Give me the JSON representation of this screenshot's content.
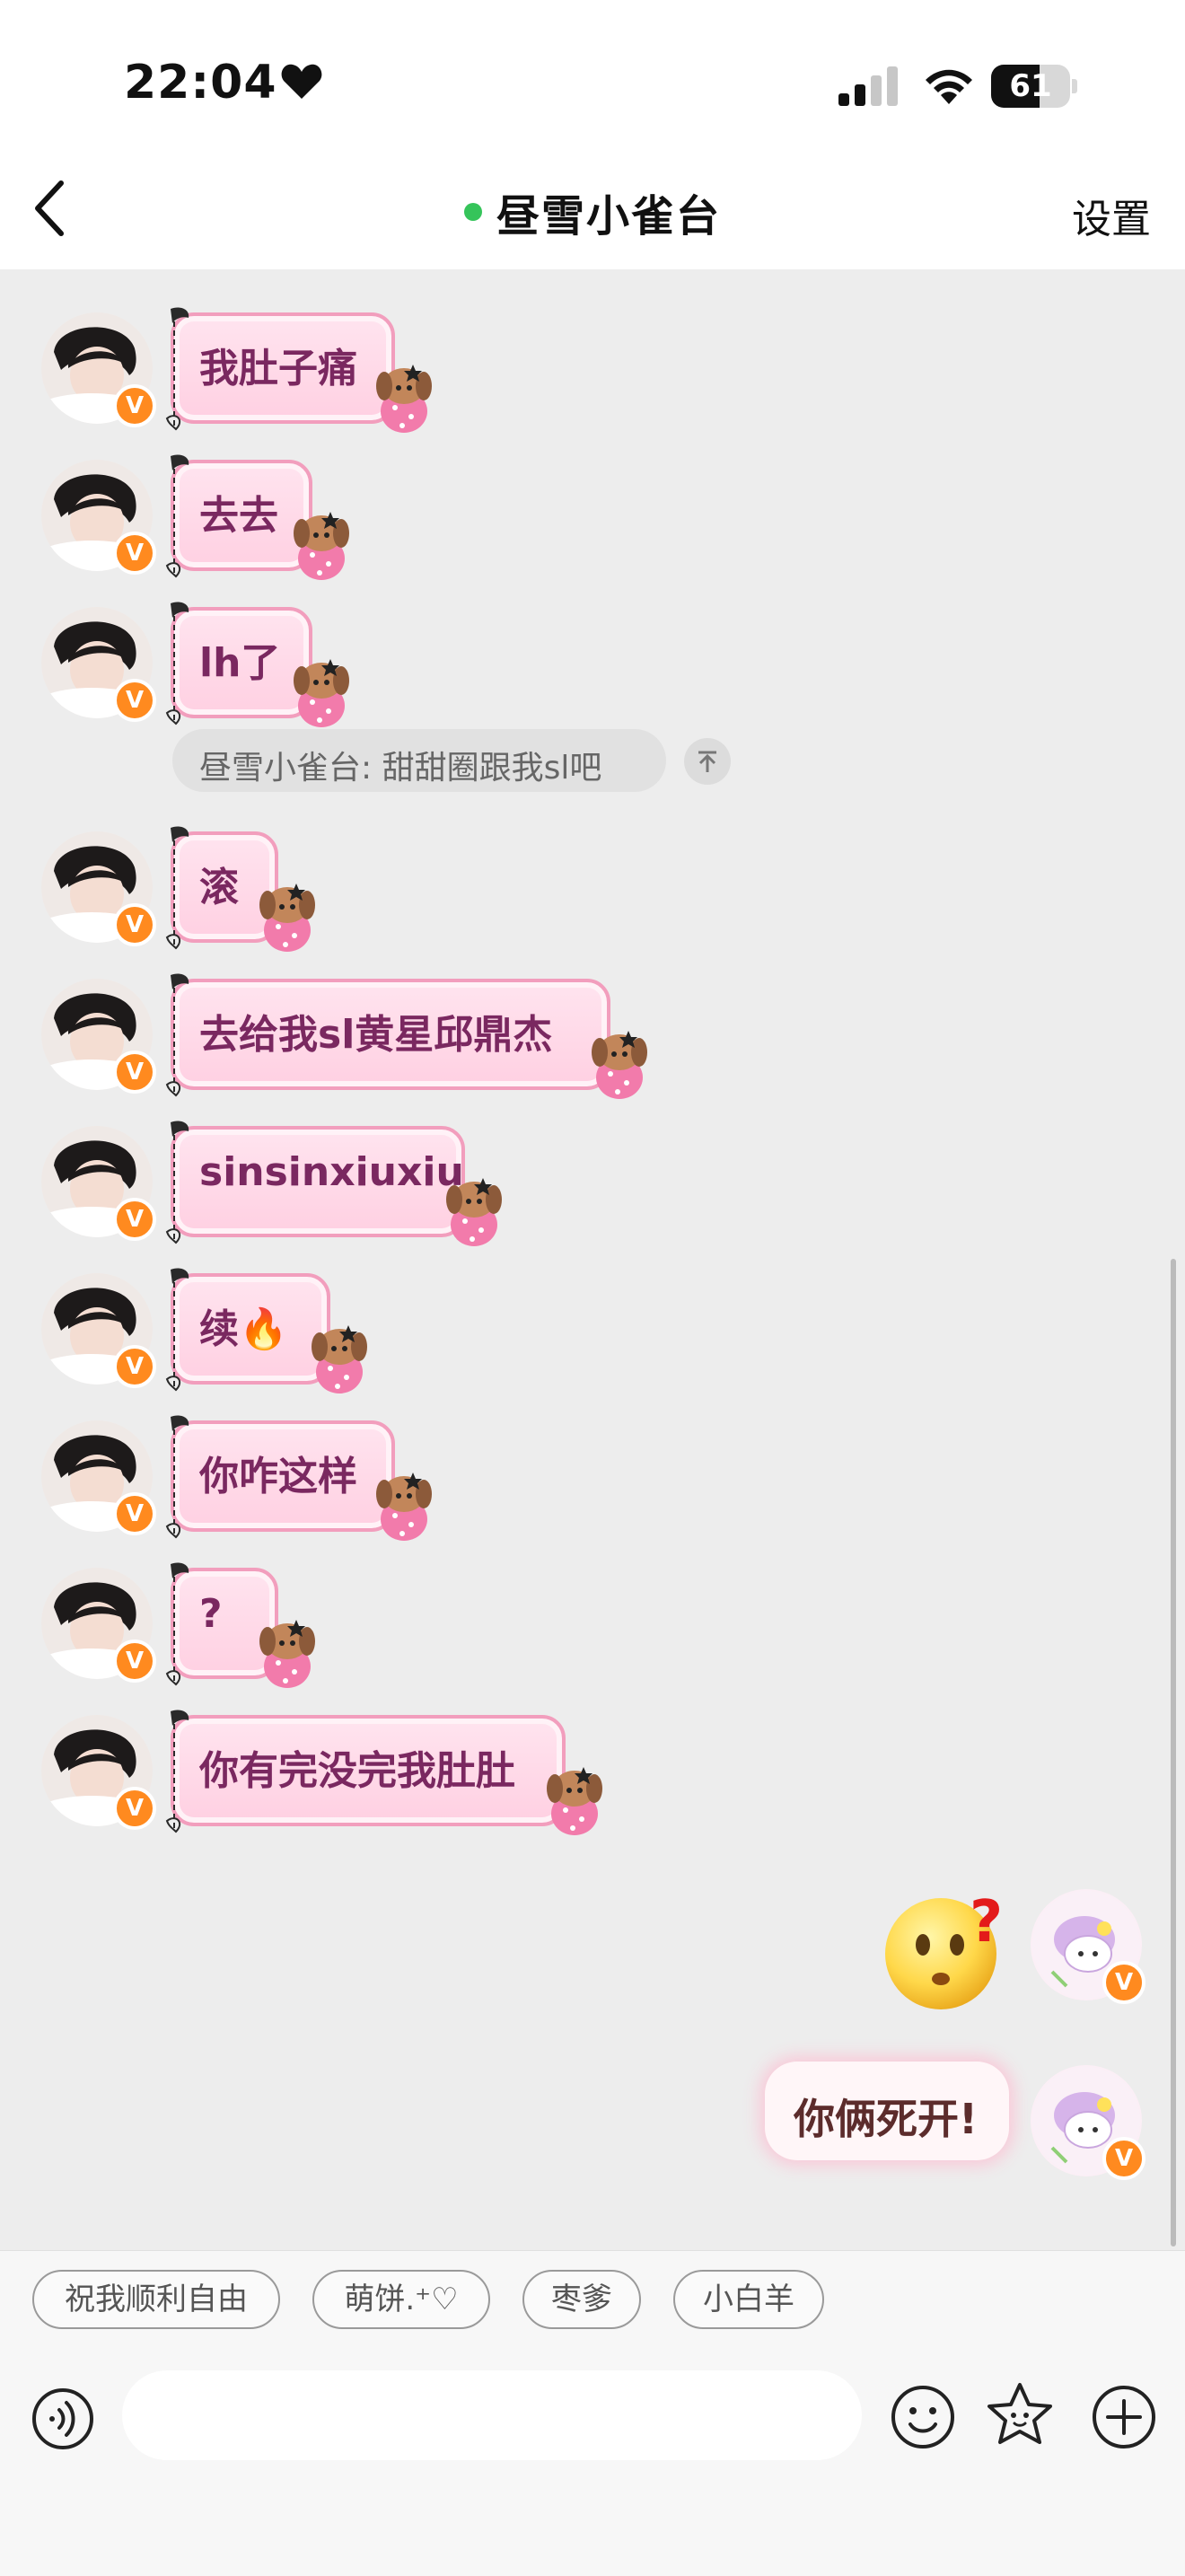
{
  "status_bar": {
    "time": "22:04",
    "battery": "61"
  },
  "header": {
    "back_icon": "chevron-left-icon",
    "title": "昼雪小雀台",
    "settings": "设置"
  },
  "messages": [
    {
      "text": "我肚子痛"
    },
    {
      "text": "去去"
    },
    {
      "text": "lh了"
    },
    {
      "text": "滚"
    },
    {
      "text": "去给我sl黄星邱鼎杰"
    },
    {
      "text": "sinsinxiuxiu"
    },
    {
      "text": "续🔥"
    },
    {
      "text": "你咋这样"
    },
    {
      "text": "?"
    },
    {
      "text": "你有完没完我肚肚"
    }
  ],
  "pinned": {
    "text": "昼雪小雀台: 甜甜圈跟我sl吧",
    "button_icon": "pin-to-top-icon"
  },
  "my_messages": [
    {
      "type": "sticker",
      "icon": "confused-face-emoji-icon"
    },
    {
      "type": "text",
      "text": "你俩死开!"
    }
  ],
  "quick_replies": [
    "祝我顺利自由",
    "萌饼.⁺♡",
    "枣爹",
    "小白羊"
  ],
  "input_bar": {
    "placeholder": ""
  },
  "colors": {
    "online": "#35c45a",
    "badge": "#ff8a1f",
    "bubble_text": "#7a2860"
  }
}
